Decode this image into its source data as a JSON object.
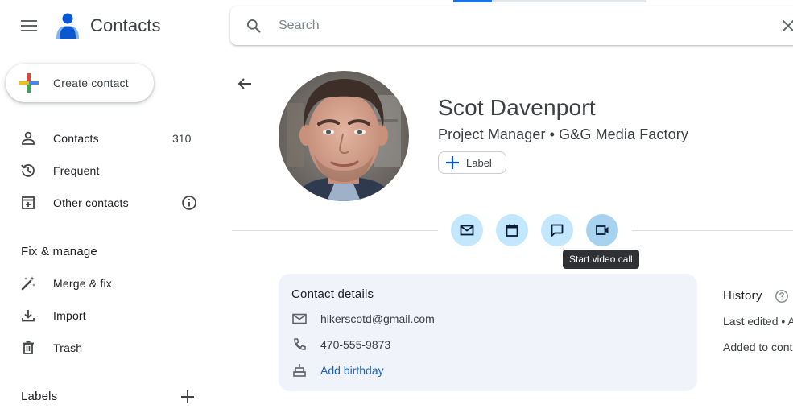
{
  "app": {
    "title": "Contacts",
    "loading_progress": 0.2
  },
  "search": {
    "placeholder": "Search",
    "value": ""
  },
  "sidebar": {
    "create_label": "Create contact",
    "items": [
      {
        "label": "Contacts",
        "count": "310",
        "icon": "person-icon"
      },
      {
        "label": "Frequent",
        "icon": "history-icon"
      },
      {
        "label": "Other contacts",
        "icon": "archive-add-icon"
      }
    ],
    "fix_section_title": "Fix & manage",
    "fix_items": [
      {
        "label": "Merge & fix",
        "icon": "magic-wand-icon"
      },
      {
        "label": "Import",
        "icon": "download-icon"
      },
      {
        "label": "Trash",
        "icon": "trash-icon"
      }
    ],
    "labels_title": "Labels"
  },
  "contact": {
    "name": "Scot Davenport",
    "subtitle": "Project Manager • G&G Media Factory",
    "label_button": "Label",
    "actions": [
      {
        "name": "email",
        "icon": "mail-icon"
      },
      {
        "name": "schedule",
        "icon": "calendar-icon"
      },
      {
        "name": "chat",
        "icon": "chat-icon"
      },
      {
        "name": "video",
        "icon": "video-icon"
      }
    ],
    "tooltip": "Start video call",
    "details": {
      "title": "Contact details",
      "email": "hikerscotd@gmail.com",
      "phone": "470-555-9873",
      "birthday_link": "Add birthday"
    },
    "history": {
      "title": "History",
      "last_edited": "Last edited • A",
      "added": "Added to cont"
    }
  },
  "colors": {
    "accent": "#1a73e8",
    "action_bg": "#c2e7ff",
    "card_bg": "#f0f4fa",
    "link": "#1a5fc8"
  }
}
